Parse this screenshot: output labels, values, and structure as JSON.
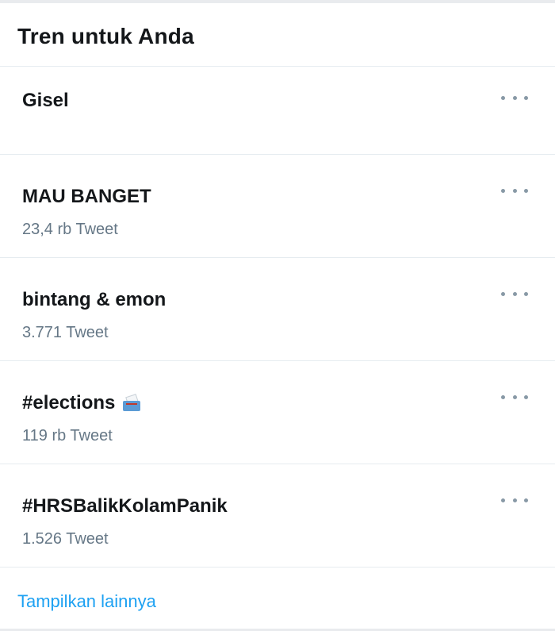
{
  "header": {
    "title": "Tren untuk Anda"
  },
  "trends": [
    {
      "name": "Gisel",
      "count": ""
    },
    {
      "name": "MAU BANGET",
      "count": "23,4 rb Tweet"
    },
    {
      "name": "bintang & emon",
      "count": "3.771 Tweet"
    },
    {
      "name": "#elections",
      "count": "119 rb Tweet",
      "icon": "ballot-box-icon"
    },
    {
      "name": "#HRSBalikKolamPanik",
      "count": "1.526 Tweet"
    }
  ],
  "footer": {
    "show_more_label": "Tampilkan lainnya"
  },
  "colors": {
    "accent": "#1da1f2",
    "text_primary": "#14171a",
    "text_secondary": "#657786",
    "divider": "#e6ecf0"
  }
}
